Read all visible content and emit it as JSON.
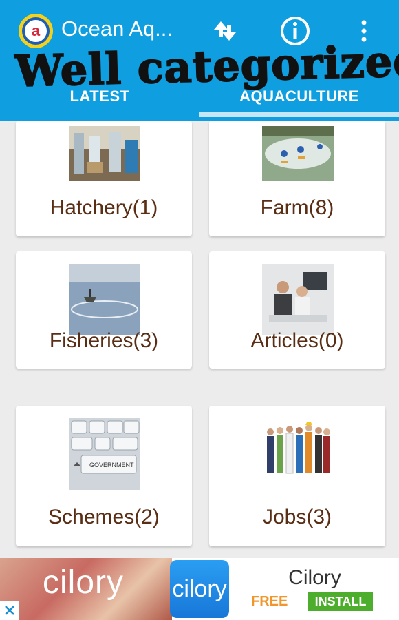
{
  "app_bar": {
    "title": "Ocean Aq...",
    "logo_letter": "a",
    "icons": [
      "sync-icon",
      "info-icon",
      "overflow-menu-icon"
    ],
    "promo_text": "Well categorized!",
    "background_color": "#0f9ee0"
  },
  "tabs": [
    {
      "label": "LATEST",
      "selected": false
    },
    {
      "label": "AQUACULTURE",
      "selected": true
    }
  ],
  "categories": [
    {
      "label": "Hatchery(1)",
      "image": "hatchery-photo"
    },
    {
      "label": "Farm(8)",
      "image": "farm-photo"
    },
    {
      "label": "Fisheries(3)",
      "image": "fisheries-photo"
    },
    {
      "label": "Articles(0)",
      "image": "articles-photo"
    },
    {
      "label": "Schemes(2)",
      "image": "schemes-photo"
    },
    {
      "label": "Jobs(3)",
      "image": "jobs-photo"
    }
  ],
  "ad": {
    "banner_text": "cilory",
    "app_icon_text": "cilory",
    "app_name": "Cilory",
    "price": "FREE",
    "install_label": "INSTALL",
    "close_icon": "close-icon"
  }
}
